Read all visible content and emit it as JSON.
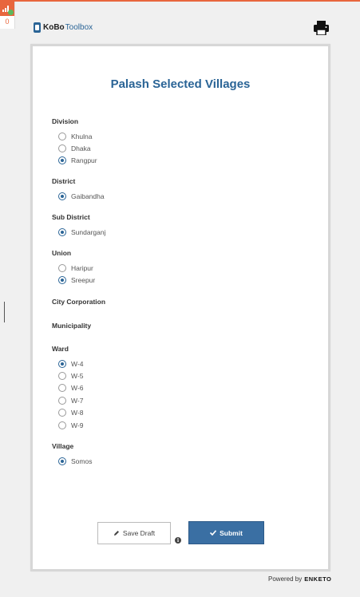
{
  "offline": {
    "queued_count": "0"
  },
  "header": {
    "logo_brand": "KoBo",
    "logo_suffix": "Toolbox"
  },
  "form": {
    "title": "Palash Selected Villages",
    "questions": [
      {
        "label": "Division",
        "options": [
          {
            "label": "Khulna",
            "checked": false
          },
          {
            "label": "Dhaka",
            "checked": false
          },
          {
            "label": "Rangpur",
            "checked": true
          }
        ]
      },
      {
        "label": "District",
        "options": [
          {
            "label": "Gaibandha",
            "checked": true
          }
        ]
      },
      {
        "label": "Sub District",
        "options": [
          {
            "label": "Sundarganj",
            "checked": true
          }
        ]
      },
      {
        "label": "Union",
        "options": [
          {
            "label": "Haripur",
            "checked": false
          },
          {
            "label": "Sreepur",
            "checked": true
          }
        ]
      },
      {
        "label": "City Corporation",
        "options": []
      },
      {
        "label": "Municipality",
        "options": []
      },
      {
        "label": "Ward",
        "options": [
          {
            "label": "W-4",
            "checked": true
          },
          {
            "label": "W-5",
            "checked": false
          },
          {
            "label": "W-6",
            "checked": false
          },
          {
            "label": "W-7",
            "checked": false
          },
          {
            "label": "W-8",
            "checked": false
          },
          {
            "label": "W-9",
            "checked": false
          }
        ]
      },
      {
        "label": "Village",
        "options": [
          {
            "label": "Somos",
            "checked": true
          }
        ]
      }
    ],
    "save_draft_label": "Save Draft",
    "submit_label": "Submit"
  },
  "footer": {
    "powered_by": "Powered by",
    "brand": "ENKETO"
  },
  "colors": {
    "accent": "#2a6496",
    "submit": "#3a6fa3",
    "top_bar": "#e8663d"
  }
}
